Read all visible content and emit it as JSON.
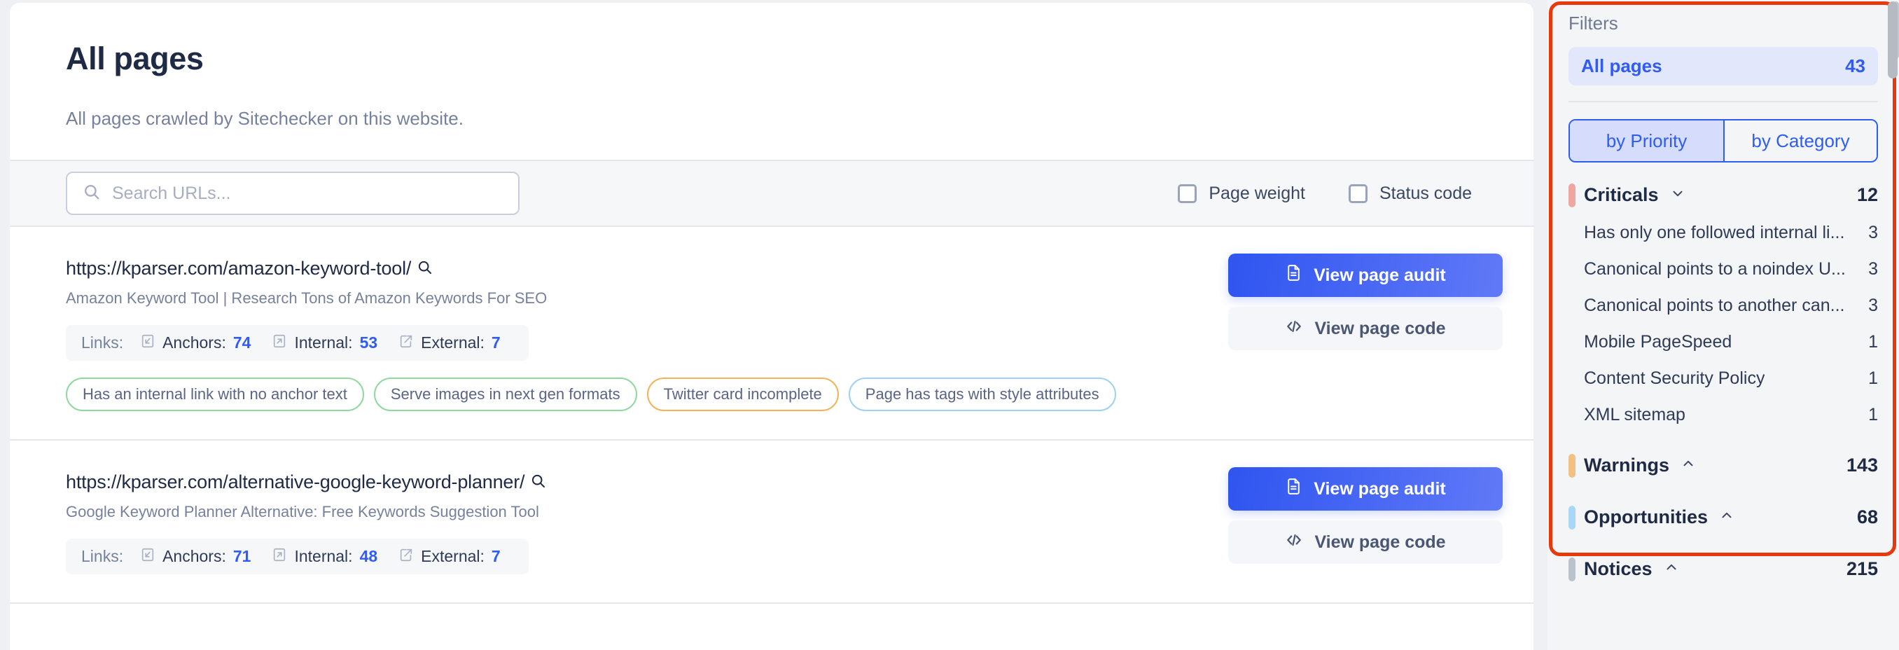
{
  "main": {
    "title": "All pages",
    "subtitle": "All pages crawled by Sitechecker on this website.",
    "search": {
      "placeholder": "Search URLs...",
      "value": ""
    },
    "checkboxes": [
      {
        "label": "Page weight",
        "checked": false
      },
      {
        "label": "Status code",
        "checked": false
      }
    ],
    "links_label": "Links:",
    "actions": {
      "audit_label": "View page audit",
      "code_label": "View page code"
    },
    "rows": [
      {
        "url": "https://kparser.com/amazon-keyword-tool/",
        "meta": "Amazon Keyword Tool | Research Tons of Amazon Keywords For SEO",
        "links": [
          {
            "label": "Anchors:",
            "value": "74",
            "icon": "anchor-link-icon"
          },
          {
            "label": "Internal:",
            "value": "53",
            "icon": "internal-link-icon"
          },
          {
            "label": "External:",
            "value": "7",
            "icon": "external-link-icon"
          }
        ],
        "tags": [
          {
            "text": "Has an internal link with no anchor text",
            "color": "green"
          },
          {
            "text": "Serve images in next gen formats",
            "color": "green"
          },
          {
            "text": "Twitter card incomplete",
            "color": "orange"
          },
          {
            "text": "Page has tags with style attributes",
            "color": "blue"
          }
        ]
      },
      {
        "url": "https://kparser.com/alternative-google-keyword-planner/",
        "meta": "Google Keyword Planner Alternative: Free Keywords Suggestion Tool",
        "links": [
          {
            "label": "Anchors:",
            "value": "71",
            "icon": "anchor-link-icon"
          },
          {
            "label": "Internal:",
            "value": "48",
            "icon": "internal-link-icon"
          },
          {
            "label": "External:",
            "value": "7",
            "icon": "external-link-icon"
          }
        ],
        "tags": []
      }
    ]
  },
  "filters": {
    "title": "Filters",
    "all_pages": {
      "label": "All pages",
      "count": "43"
    },
    "segments": [
      {
        "label": "by Priority",
        "active": true
      },
      {
        "label": "by Category",
        "active": false
      }
    ],
    "groups": [
      {
        "name": "Criticals",
        "count": "12",
        "color": "#efa6a0",
        "expanded": true,
        "chevron": "chevron-down-icon",
        "items": [
          {
            "label": "Has only one followed internal li...",
            "count": "3"
          },
          {
            "label": "Canonical points to a noindex U...",
            "count": "3"
          },
          {
            "label": "Canonical points to another can...",
            "count": "3"
          },
          {
            "label": "Mobile PageSpeed",
            "count": "1"
          },
          {
            "label": "Content Security Policy",
            "count": "1"
          },
          {
            "label": "XML sitemap",
            "count": "1"
          }
        ]
      },
      {
        "name": "Warnings",
        "count": "143",
        "color": "#f0c182",
        "expanded": false,
        "chevron": "chevron-up-icon",
        "items": []
      },
      {
        "name": "Opportunities",
        "count": "68",
        "color": "#a8d8f5",
        "expanded": false,
        "chevron": "chevron-up-icon",
        "items": []
      },
      {
        "name": "Notices",
        "count": "215",
        "color": "#bcc2cc",
        "expanded": false,
        "chevron": "chevron-up-icon",
        "items": []
      }
    ]
  },
  "colors": {
    "accent_blue": "#2f5cf5",
    "annotation_red": "#e8380d",
    "text_dark": "#1f2a44",
    "text_muted": "#76819c"
  }
}
